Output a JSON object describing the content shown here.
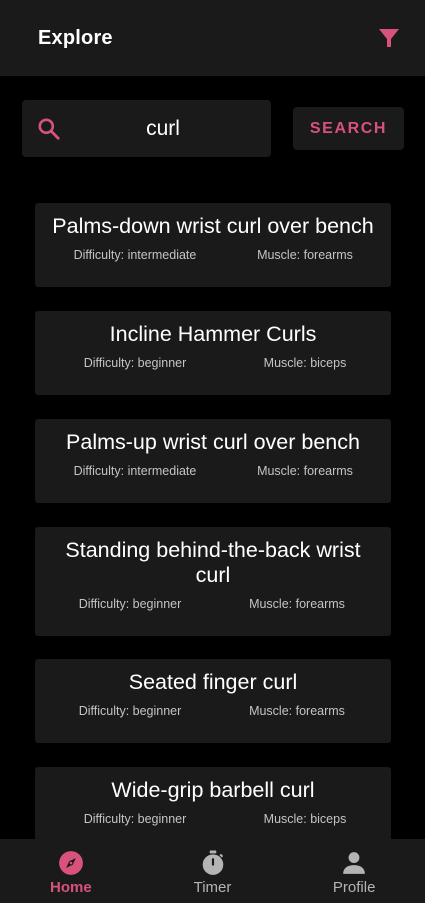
{
  "header": {
    "title": "Explore",
    "filter_icon": "filter-icon"
  },
  "colors": {
    "accent": "#d9527b",
    "surface": "#1a1a1a",
    "background": "#000000"
  },
  "search": {
    "value": "curl",
    "placeholder": "",
    "button_label": "SEARCH",
    "icon": "search-icon"
  },
  "results": [
    {
      "title": "Palms-down wrist curl over bench",
      "difficulty": "Difficulty: intermediate",
      "muscle": "Muscle: forearms"
    },
    {
      "title": "Incline Hammer Curls",
      "difficulty": "Difficulty: beginner",
      "muscle": "Muscle: biceps"
    },
    {
      "title": "Palms-up wrist curl over bench",
      "difficulty": "Difficulty: intermediate",
      "muscle": "Muscle: forearms"
    },
    {
      "title": "Standing behind-the-back wrist curl",
      "difficulty": "Difficulty: beginner",
      "muscle": "Muscle: forearms"
    },
    {
      "title": "Seated finger curl",
      "difficulty": "Difficulty: beginner",
      "muscle": "Muscle: forearms"
    },
    {
      "title": "Wide-grip barbell curl",
      "difficulty": "Difficulty: beginner",
      "muscle": "Muscle: biceps"
    }
  ],
  "bottom_nav": {
    "items": [
      {
        "label": "Home",
        "icon": "compass-icon",
        "active": true
      },
      {
        "label": "Timer",
        "icon": "stopwatch-icon",
        "active": false
      },
      {
        "label": "Profile",
        "icon": "person-icon",
        "active": false
      }
    ]
  }
}
